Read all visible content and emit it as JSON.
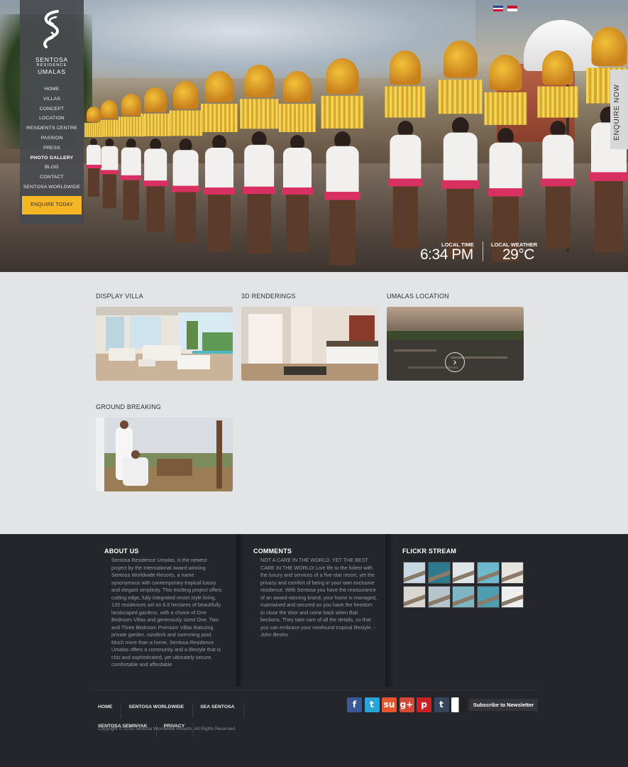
{
  "brand": {
    "line1": "SENTOSA",
    "line2": "RESIDENCE",
    "line3": "UMALAS"
  },
  "nav": [
    "HOME",
    "VILLAS",
    "CONCEPT",
    "LOCATION",
    "RESIDENTS CENTRE",
    "PASSION",
    "PRESS",
    "PHOTO GALLERY",
    "BLOG",
    "CONTACT",
    "SENTOSA WORLDWIDE"
  ],
  "nav_active": "PHOTO GALLERY",
  "enquire_today": "ENQUIRE TODAY",
  "enquire_now": "ENQUIRE NOW",
  "local_time": {
    "label": "LOCAL TIME",
    "value": "6:34 PM"
  },
  "local_weather": {
    "label": "LOCAL WEATHER",
    "value": "29°C"
  },
  "gallery": [
    {
      "title": "DISPLAY VILLA"
    },
    {
      "title": "3D RENDERINGS"
    },
    {
      "title": "UMALAS LOCATION"
    },
    {
      "title": "GROUND BREAKING"
    }
  ],
  "footer": {
    "about": {
      "title": "ABOUT US",
      "text": "Sentosa Residence Umalas, is the newest project by the International award winning Sentosa Worldwide Resorts, a name synonymous with contemporary tropical luxury and elegant simplicity. This exciting project offers cutting edge, fully integrated resort style living, 133 residences set on 6.5 hectares of beautifully landscaped gardens, with a choice of One Bedroom Villas and generously sized One, Two and Three Bedroom Premium Villas featuring private garden, sundeck and swimming pool. Much more than a home, Sentosa Residence Umalas offers a community and a lifestyle that is chic and sophisticated, yet ultimately secure, comfortable and affordable."
    },
    "comments": {
      "title": "COMMENTS",
      "text": "NOT A CARE IN THE WORLD, YET THE BEST CARE IN THE WORLD! Live life to the fullest with the luxury and services of a five-star resort, yet the privacy and comfort of being in your own exclusive residence. With Sentosa you have the reassurance of an award-winning brand, your home is managed, maintained and secured so you have the freedom to close the door and come back when Bali beckons. They take care of all the details, so that you can embrace your newfound tropical lifestyle. -",
      "author": "John Bevins"
    },
    "flickr": {
      "title": "FLICKR STREAM"
    },
    "links_row1": [
      "HOME",
      "SENTOSA WORLDWIDE",
      "SEA SENTOSA"
    ],
    "links_row2": [
      "SENTOSA SEMINYAK",
      "PRIVACY"
    ],
    "copyright": "Copyright © 2015 Sentosa Worldwide Resorts. All Rights Reserved.",
    "social": [
      {
        "icon": "facebook-icon",
        "glyph": "f",
        "color": "#3b5998"
      },
      {
        "icon": "twitter-icon",
        "glyph": "t",
        "color": "#2aa3d6"
      },
      {
        "icon": "stumbleupon-icon",
        "glyph": "su",
        "color": "#e4572e"
      },
      {
        "icon": "google-plus-icon",
        "glyph": "g+",
        "color": "#d34836"
      },
      {
        "icon": "pinterest-icon",
        "glyph": "p",
        "color": "#cb2027"
      },
      {
        "icon": "tumblr-icon",
        "glyph": "t",
        "color": "#35465c"
      },
      {
        "icon": "delicious-icon",
        "glyph": "",
        "color": "#ffffff"
      }
    ],
    "subscribe": "Subscribe to Newsletter"
  }
}
